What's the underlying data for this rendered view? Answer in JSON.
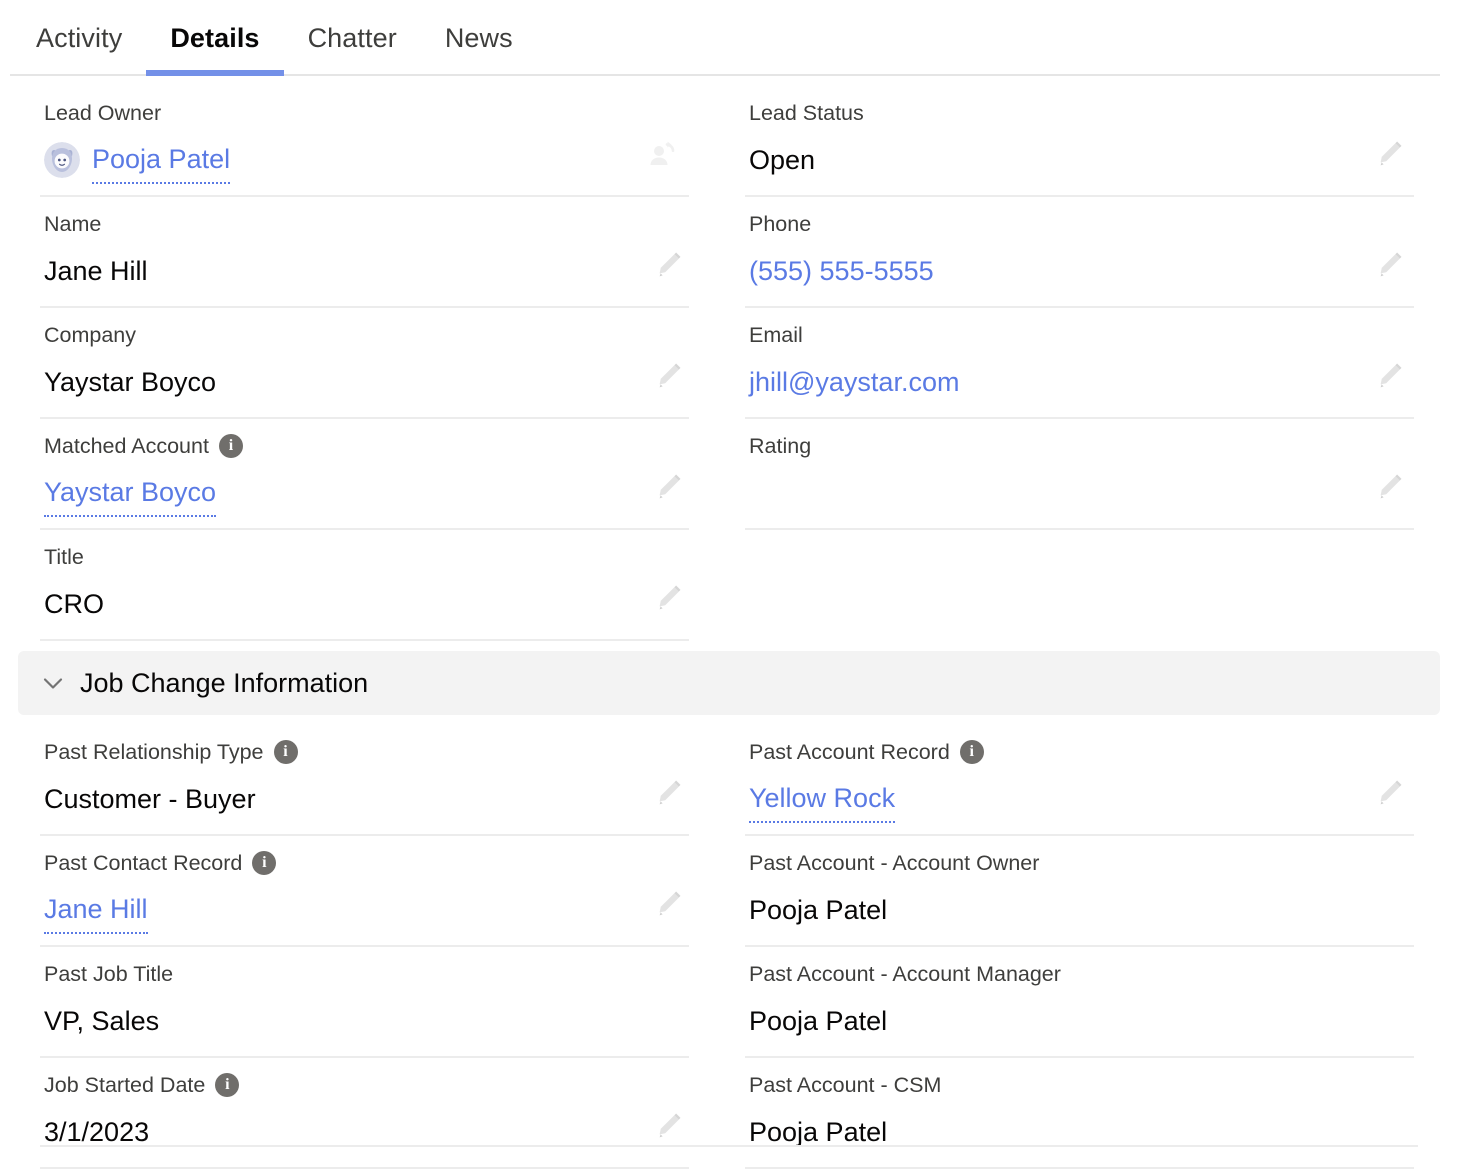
{
  "tabs": [
    {
      "label": "Activity",
      "active": false
    },
    {
      "label": "Details",
      "active": true
    },
    {
      "label": "Chatter",
      "active": false
    },
    {
      "label": "News",
      "active": false
    }
  ],
  "details": {
    "left": [
      {
        "label": "Lead Owner",
        "value": "Pooja Patel",
        "value_type": "link-dotted",
        "avatar": "astro-avatar",
        "info": false,
        "action_icon": "change-owner-icon"
      },
      {
        "label": "Name",
        "value": "Jane Hill",
        "value_type": "text",
        "info": false,
        "action_icon": "edit-pencil-icon"
      },
      {
        "label": "Company",
        "value": "Yaystar Boyco",
        "value_type": "text",
        "info": false,
        "action_icon": "edit-pencil-icon"
      },
      {
        "label": "Matched Account",
        "value": "Yaystar Boyco",
        "value_type": "link-dotted",
        "info": true,
        "action_icon": "edit-pencil-icon"
      },
      {
        "label": "Title",
        "value": "CRO",
        "value_type": "text",
        "info": false,
        "action_icon": "edit-pencil-icon"
      }
    ],
    "right": [
      {
        "label": "Lead Status",
        "value": "Open",
        "value_type": "text",
        "info": false,
        "action_icon": "edit-pencil-icon"
      },
      {
        "label": "Phone",
        "value": "(555) 555-5555",
        "value_type": "link-plain",
        "info": false,
        "action_icon": "edit-pencil-icon"
      },
      {
        "label": "Email",
        "value": "jhill@yaystar.com",
        "value_type": "link-plain",
        "info": false,
        "action_icon": "edit-pencil-icon"
      },
      {
        "label": "Rating",
        "value": "",
        "value_type": "text",
        "info": false,
        "action_icon": "edit-pencil-icon"
      }
    ]
  },
  "job_change_section": {
    "title": "Job Change Information",
    "expanded": true,
    "collapse_icon": "chevron-down-icon",
    "left": [
      {
        "label": "Past Relationship Type",
        "value": "Customer - Buyer",
        "value_type": "text",
        "info": true,
        "action_icon": "edit-pencil-icon"
      },
      {
        "label": "Past Contact Record",
        "value": "Jane Hill",
        "value_type": "link-dotted",
        "info": true,
        "action_icon": "edit-pencil-icon"
      },
      {
        "label": "Past Job Title",
        "value": "VP, Sales",
        "value_type": "text",
        "info": false,
        "action_icon": ""
      },
      {
        "label": "Job Started Date",
        "value": "3/1/2023",
        "value_type": "text",
        "info": true,
        "action_icon": "edit-pencil-icon"
      }
    ],
    "right": [
      {
        "label": "Past Account Record",
        "value": "Yellow Rock",
        "value_type": "link-dotted",
        "info": true,
        "action_icon": "edit-pencil-icon"
      },
      {
        "label": "Past Account - Account Owner",
        "value": "Pooja Patel",
        "value_type": "text",
        "info": false,
        "action_icon": ""
      },
      {
        "label": "Past Account - Account Manager",
        "value": "Pooja Patel",
        "value_type": "text",
        "info": false,
        "action_icon": ""
      },
      {
        "label": "Past Account - CSM",
        "value": "Pooja Patel",
        "value_type": "text",
        "info": false,
        "action_icon": ""
      }
    ]
  },
  "colors": {
    "link": "#5a7ae4",
    "active_tab_underline": "#7390e8",
    "label_text": "#3e3e3c",
    "value_text": "#080707",
    "section_band": "#f3f3f3",
    "divider": "#ececec",
    "info_icon_bg": "#706e6b"
  }
}
